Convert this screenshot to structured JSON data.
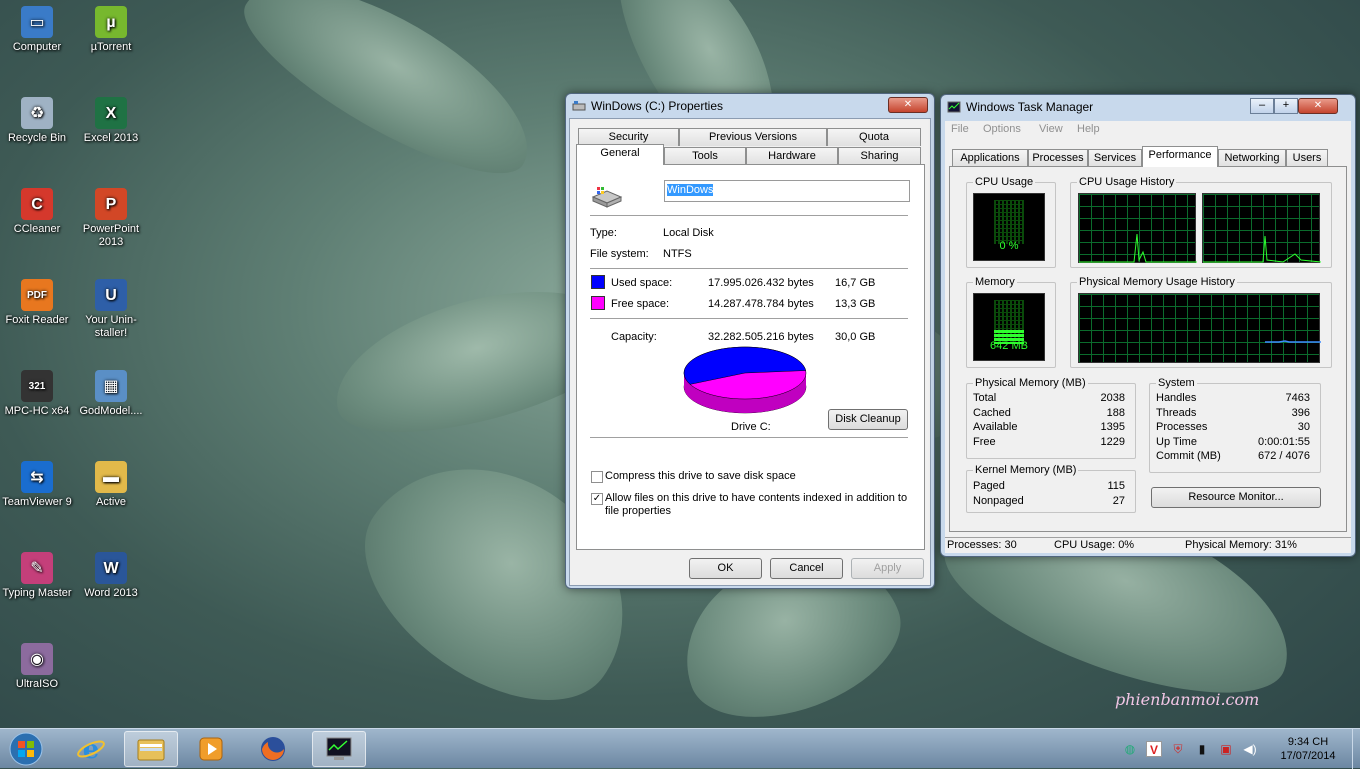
{
  "desktop": {
    "icons": [
      {
        "label": "Computer",
        "icon": "computer-icon",
        "color": "#3a7bc8",
        "glyph": "▭"
      },
      {
        "label": "µTorrent",
        "icon": "utorrent-icon",
        "color": "#77b82e",
        "glyph": "µ"
      },
      {
        "label": "Recycle Bin",
        "icon": "recycle-bin-icon",
        "color": "#9fb2c4",
        "glyph": "♻"
      },
      {
        "label": "Excel 2013",
        "icon": "excel-icon",
        "color": "#1f7244",
        "glyph": "X"
      },
      {
        "label": "CCleaner",
        "icon": "ccleaner-icon",
        "color": "#d5382c",
        "glyph": "C"
      },
      {
        "label": "PowerPoint 2013",
        "icon": "powerpoint-icon",
        "color": "#d24726",
        "glyph": "P"
      },
      {
        "label": "Foxit Reader",
        "icon": "foxit-reader-icon",
        "color": "#e8771f",
        "glyph": "PDF"
      },
      {
        "label": "Your Unin-staller!",
        "icon": "uninstaller-icon",
        "color": "#2e5fa8",
        "glyph": "U"
      },
      {
        "label": "MPC-HC x64",
        "icon": "mpc-hc-icon",
        "color": "#333333",
        "glyph": "321"
      },
      {
        "label": "GodModel....",
        "icon": "godmode-icon",
        "color": "#5a8fc6",
        "glyph": "▦"
      },
      {
        "label": "TeamViewer 9",
        "icon": "teamviewer-icon",
        "color": "#1a6dcf",
        "glyph": "⇆"
      },
      {
        "label": "Active",
        "icon": "folder-icon",
        "color": "#e2b94a",
        "glyph": "▬"
      },
      {
        "label": "Typing Master",
        "icon": "typing-master-icon",
        "color": "#c43f7a",
        "glyph": "✎"
      },
      {
        "label": "Word 2013",
        "icon": "word-icon",
        "color": "#2a5699",
        "glyph": "W"
      },
      {
        "label": "UltraISO",
        "icon": "ultraiso-icon",
        "color": "#8c6b9e",
        "glyph": "◉"
      }
    ],
    "watermark": "phienbanmoi.com"
  },
  "props": {
    "title": "WinDows (C:) Properties",
    "close_glyph": "✕",
    "tabs_row1": [
      "Security",
      "Previous Versions",
      "Quota"
    ],
    "tabs_row2": [
      "General",
      "Tools",
      "Hardware",
      "Sharing"
    ],
    "drive_name": "WinDows",
    "type_label": "Type:",
    "type_value": "Local Disk",
    "fs_label": "File system:",
    "fs_value": "NTFS",
    "used_label": "Used space:",
    "used_bytes": "17.995.026.432 bytes",
    "used_gb": "16,7 GB",
    "free_label": "Free space:",
    "free_bytes": "14.287.478.784 bytes",
    "free_gb": "13,3 GB",
    "cap_label": "Capacity:",
    "cap_bytes": "32.282.505.216 bytes",
    "cap_gb": "30,0 GB",
    "drive_label": "Drive C:",
    "cleanup": "Disk Cleanup",
    "compress": "Compress this drive to save disk space",
    "index_line1": "Allow files on this drive to have contents indexed in addition to",
    "index_line2": "file properties",
    "ok": "OK",
    "cancel": "Cancel",
    "apply": "Apply",
    "used_color": "#0000ff",
    "free_color": "#ff00ff",
    "used_fraction": 0.557
  },
  "tm": {
    "title": "Windows Task Manager",
    "min_glyph": "–",
    "max_glyph": "+",
    "close_glyph": "✕",
    "menu": [
      "File",
      "Options",
      "View",
      "Help"
    ],
    "tabs": [
      "Applications",
      "Processes",
      "Services",
      "Performance",
      "Networking",
      "Users"
    ],
    "cpu_usage_title": "CPU Usage",
    "cpu_value": "0 %",
    "cpu_history_title": "CPU Usage History",
    "memory_title": "Memory",
    "memory_value": "642 MB",
    "pmem_history_title": "Physical Memory Usage History",
    "physmem": {
      "title": "Physical Memory (MB)",
      "rows": [
        [
          "Total",
          "2038"
        ],
        [
          "Cached",
          "188"
        ],
        [
          "Available",
          "1395"
        ],
        [
          "Free",
          "1229"
        ]
      ]
    },
    "system": {
      "title": "System",
      "rows": [
        [
          "Handles",
          "7463"
        ],
        [
          "Threads",
          "396"
        ],
        [
          "Processes",
          "30"
        ],
        [
          "Up Time",
          "0:00:01:55"
        ],
        [
          "Commit (MB)",
          "672 / 4076"
        ]
      ]
    },
    "kernel": {
      "title": "Kernel Memory (MB)",
      "rows": [
        [
          "Paged",
          "115"
        ],
        [
          "Nonpaged",
          "27"
        ]
      ]
    },
    "resource_monitor": "Resource Monitor...",
    "status": {
      "processes": "Processes: 30",
      "cpu": "CPU Usage: 0%",
      "mem": "Physical Memory: 31%"
    }
  },
  "taskbar": {
    "clock_time": "9:34 CH",
    "clock_date": "17/07/2014"
  }
}
